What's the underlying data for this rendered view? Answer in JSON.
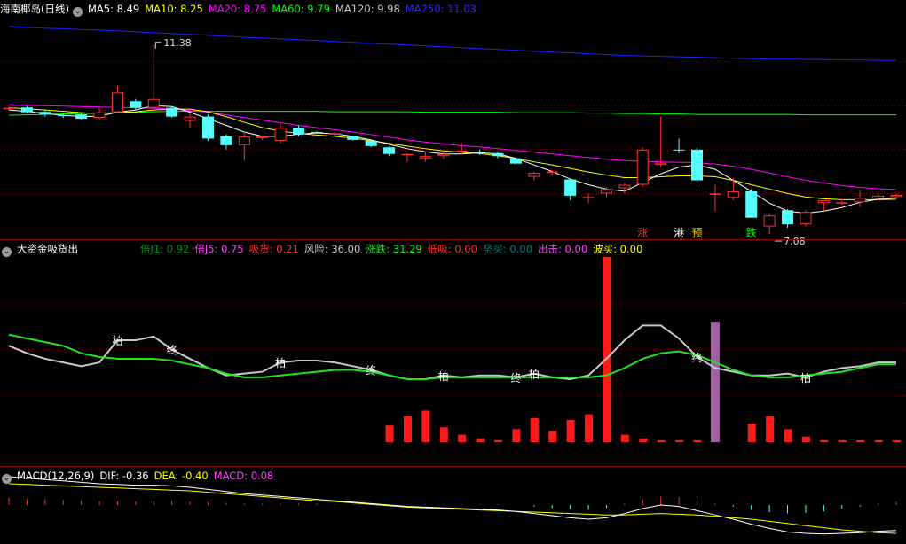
{
  "colors": {
    "up": "#ff3030",
    "down": "#54ffff",
    "ma5": "#ffffff",
    "ma10": "#ffff00",
    "ma20": "#ff00ff",
    "ma60": "#00ff00",
    "ma120": "#c8c8c8",
    "ma250": "#2020ff"
  },
  "main": {
    "title": "海南椰岛(日线)",
    "legend": [
      {
        "label": "MA5: 8.49",
        "color": "#ffffff"
      },
      {
        "label": "MA10: 8.25",
        "color": "#ffff00"
      },
      {
        "label": "MA20: 8.75",
        "color": "#ff00ff"
      },
      {
        "label": "MA60: 9.79",
        "color": "#00ff00"
      },
      {
        "label": "MA120: 9.98",
        "color": "#c8c8c8"
      },
      {
        "label": "MA250: 11.03",
        "color": "#2828ff"
      }
    ],
    "high_label": "11.38",
    "low_label": "7.08",
    "signals": [
      {
        "text": "涨",
        "i": 35,
        "color": "#ff3030"
      },
      {
        "text": "港",
        "i": 37,
        "color": "#ffffff"
      },
      {
        "text": "预",
        "i": 38,
        "color": "#ffd000"
      },
      {
        "text": "跌",
        "i": 41,
        "color": "#00ff00"
      }
    ]
  },
  "ind": {
    "title": "大资金吸货出",
    "legend": [
      {
        "label": "倍J1: 0.92",
        "color": "#009000"
      },
      {
        "label": "倍J5: 0.75",
        "color": "#ff40ff"
      },
      {
        "label": "吸货: 0.21",
        "color": "#ff3030"
      },
      {
        "label": "风险: 36.00",
        "color": "#c8c8c8"
      },
      {
        "label": "涨跌: 31.29",
        "color": "#00ff00"
      },
      {
        "label": "低吸: 0.00",
        "color": "#ff3030"
      },
      {
        "label": "坚买: 0.00",
        "color": "#007a7a"
      },
      {
        "label": "出击: 0.00",
        "color": "#ff40ff"
      },
      {
        "label": "波买: 0.00",
        "color": "#ffff00"
      }
    ],
    "marks": [
      {
        "text": "柏",
        "i": 6
      },
      {
        "text": "终",
        "i": 9
      },
      {
        "text": "柏",
        "i": 15
      },
      {
        "text": "终",
        "i": 20
      },
      {
        "text": "柏",
        "i": 24
      },
      {
        "text": "终",
        "i": 28
      },
      {
        "text": "柏",
        "i": 29
      },
      {
        "text": "终",
        "i": 38
      },
      {
        "text": "柏",
        "i": 44
      }
    ]
  },
  "macd": {
    "title": "MACD(12,26,9)",
    "legend": [
      {
        "label": "DIF: -0.36",
        "color": "#ffffff"
      },
      {
        "label": "DEA: -0.40",
        "color": "#ffff00"
      },
      {
        "label": "MACD: 0.08",
        "color": "#ff40ff"
      }
    ]
  },
  "chart_data": [
    {
      "type": "candlestick",
      "title": "海南椰岛(日线)",
      "candles": [
        [
          9.92,
          9.98,
          9.88,
          9.95
        ],
        [
          9.96,
          10.0,
          9.82,
          9.85
        ],
        [
          9.86,
          9.9,
          9.75,
          9.8
        ],
        [
          9.78,
          9.82,
          9.72,
          9.76
        ],
        [
          9.8,
          9.84,
          9.68,
          9.7
        ],
        [
          9.72,
          9.95,
          9.68,
          9.85
        ],
        [
          9.85,
          10.45,
          9.82,
          10.3
        ],
        [
          10.1,
          10.15,
          9.9,
          9.95
        ],
        [
          9.95,
          11.38,
          9.9,
          10.15
        ],
        [
          9.95,
          9.98,
          9.72,
          9.75
        ],
        [
          9.65,
          9.82,
          9.5,
          9.75
        ],
        [
          9.75,
          9.8,
          9.2,
          9.25
        ],
        [
          9.3,
          9.35,
          9.0,
          9.1
        ],
        [
          9.1,
          9.4,
          8.75,
          9.3
        ],
        [
          9.26,
          9.32,
          9.22,
          9.3
        ],
        [
          9.2,
          9.6,
          9.15,
          9.5
        ],
        [
          9.5,
          9.55,
          9.3,
          9.35
        ],
        [
          9.4,
          9.42,
          9.36,
          9.38
        ],
        [
          9.36,
          9.4,
          9.32,
          9.37
        ],
        [
          9.3,
          9.32,
          9.2,
          9.22
        ],
        [
          9.2,
          9.22,
          9.05,
          9.08
        ],
        [
          9.05,
          9.07,
          8.85,
          8.9
        ],
        [
          8.88,
          8.92,
          8.72,
          8.9
        ],
        [
          8.8,
          8.95,
          8.72,
          8.85
        ],
        [
          8.85,
          8.95,
          8.78,
          8.9
        ],
        [
          8.96,
          9.15,
          8.9,
          8.98
        ],
        [
          8.95,
          9.0,
          8.88,
          8.93
        ],
        [
          8.92,
          8.95,
          8.8,
          8.85
        ],
        [
          8.8,
          8.82,
          8.65,
          8.68
        ],
        [
          8.38,
          8.5,
          8.3,
          8.47
        ],
        [
          8.5,
          8.54,
          8.42,
          8.5
        ],
        [
          8.32,
          8.34,
          7.85,
          7.95
        ],
        [
          7.9,
          8.0,
          7.78,
          7.92
        ],
        [
          8.0,
          8.15,
          7.9,
          8.1
        ],
        [
          8.12,
          8.25,
          8.0,
          8.2
        ],
        [
          8.2,
          9.05,
          8.15,
          9.0
        ],
        [
          8.65,
          9.75,
          8.6,
          8.7
        ],
        [
          9.0,
          9.25,
          8.92,
          8.98
        ],
        [
          9.0,
          9.03,
          8.15,
          8.3
        ],
        [
          8.0,
          8.2,
          7.6,
          8.0
        ],
        [
          7.9,
          8.35,
          7.85,
          8.05
        ],
        [
          8.05,
          8.1,
          7.45,
          7.45
        ],
        [
          7.25,
          7.55,
          7.08,
          7.5
        ],
        [
          7.62,
          7.65,
          7.22,
          7.3
        ],
        [
          7.3,
          7.62,
          7.25,
          7.58
        ],
        [
          7.78,
          7.82,
          7.62,
          7.85
        ],
        [
          7.8,
          7.88,
          7.74,
          7.8
        ],
        [
          7.8,
          8.08,
          7.7,
          7.9
        ],
        [
          7.88,
          8.05,
          7.85,
          7.95
        ],
        [
          7.92,
          8.0,
          7.9,
          7.97
        ]
      ],
      "ma5": [
        9.9,
        9.87,
        9.82,
        9.78,
        9.75,
        9.76,
        9.85,
        9.9,
        10.0,
        9.98,
        9.85,
        9.7,
        9.55,
        9.4,
        9.3,
        9.3,
        9.35,
        9.38,
        9.36,
        9.3,
        9.22,
        9.12,
        9.02,
        8.95,
        8.9,
        8.9,
        8.93,
        8.9,
        8.8,
        8.65,
        8.5,
        8.33,
        8.2,
        8.1,
        8.05,
        8.25,
        8.45,
        8.6,
        8.65,
        8.55,
        8.3,
        8.05,
        7.78,
        7.6,
        7.55,
        7.6,
        7.68,
        7.8,
        7.87,
        7.9
      ],
      "ma10": [
        9.95,
        9.93,
        9.9,
        9.87,
        9.84,
        9.82,
        9.84,
        9.86,
        9.9,
        9.92,
        9.92,
        9.86,
        9.75,
        9.62,
        9.5,
        9.42,
        9.37,
        9.33,
        9.3,
        9.26,
        9.2,
        9.14,
        9.08,
        9.02,
        8.97,
        8.94,
        8.91,
        8.86,
        8.8,
        8.72,
        8.65,
        8.57,
        8.49,
        8.42,
        8.36,
        8.36,
        8.38,
        8.4,
        8.4,
        8.38,
        8.3,
        8.2,
        8.1,
        8.0,
        7.92,
        7.88,
        7.86,
        7.86,
        7.86,
        7.87
      ],
      "ma20": [
        10.02,
        10.01,
        10.0,
        9.99,
        9.98,
        9.97,
        9.96,
        9.95,
        9.94,
        9.92,
        9.89,
        9.85,
        9.79,
        9.73,
        9.67,
        9.61,
        9.55,
        9.5,
        9.45,
        9.4,
        9.34,
        9.28,
        9.22,
        9.17,
        9.13,
        9.09,
        9.06,
        9.02,
        8.98,
        8.94,
        8.9,
        8.86,
        8.82,
        8.78,
        8.75,
        8.73,
        8.72,
        8.71,
        8.7,
        8.67,
        8.62,
        8.55,
        8.47,
        8.38,
        8.3,
        8.24,
        8.18,
        8.14,
        8.11,
        8.09
      ],
      "ma60": [
        9.78,
        9.79,
        9.8,
        9.81,
        9.82,
        9.83,
        9.84,
        9.85,
        9.86,
        9.87,
        9.87,
        9.87,
        9.87,
        9.87,
        9.87,
        9.87,
        9.87,
        9.87,
        9.86,
        9.86,
        9.86,
        9.86,
        9.86,
        9.85,
        9.85,
        9.85,
        9.85,
        9.85,
        9.84,
        9.84,
        9.84,
        9.84,
        9.83,
        9.83,
        9.82,
        9.82,
        9.81,
        9.81,
        9.8,
        9.8,
        9.8,
        9.8,
        9.8,
        9.8,
        9.79,
        9.79,
        9.79,
        9.79,
        9.79,
        9.79
      ],
      "ma250": [
        11.8,
        11.78,
        11.76,
        11.75,
        11.73,
        11.72,
        11.7,
        11.68,
        11.66,
        11.64,
        11.62,
        11.6,
        11.58,
        11.56,
        11.54,
        11.52,
        11.5,
        11.48,
        11.46,
        11.44,
        11.42,
        11.4,
        11.38,
        11.36,
        11.34,
        11.32,
        11.3,
        11.28,
        11.26,
        11.24,
        11.22,
        11.2,
        11.18,
        11.16,
        11.14,
        11.13,
        11.12,
        11.11,
        11.1,
        11.09,
        11.08,
        11.07,
        11.06,
        11.06,
        11.05,
        11.05,
        11.04,
        11.04,
        11.03,
        11.03
      ],
      "price_range": [
        7.0,
        12.0
      ]
    },
    {
      "type": "line+bar",
      "title": "大资金吸货出",
      "line_white": [
        52,
        48,
        45,
        43,
        41,
        43,
        55,
        55,
        57,
        50,
        45,
        40,
        36,
        37,
        38,
        43,
        44,
        44,
        43,
        41,
        39,
        36,
        34,
        34,
        36,
        35,
        36,
        36,
        35,
        37,
        35,
        34,
        36,
        45,
        55,
        63,
        63,
        56,
        46,
        40,
        38,
        36,
        36,
        37,
        35,
        38,
        40,
        41,
        43,
        43
      ],
      "line_green": [
        58,
        56,
        54,
        52,
        48,
        46,
        45,
        45,
        45,
        44,
        42,
        40,
        37,
        35,
        35,
        36,
        37,
        38,
        39,
        39,
        38,
        36,
        34,
        34,
        35,
        35,
        35,
        35,
        35,
        35,
        35,
        35,
        35,
        36,
        40,
        45,
        48,
        49,
        47,
        43,
        39,
        36,
        35,
        35,
        36,
        37,
        38,
        40,
        42,
        42
      ],
      "bars_red": [
        0,
        0,
        0,
        0,
        0,
        0,
        0,
        0,
        0,
        0,
        0,
        0,
        0,
        0,
        0,
        0,
        0,
        0,
        0,
        0,
        0,
        9,
        14,
        17,
        8,
        4,
        2,
        1,
        7,
        13,
        6,
        12,
        15,
        100,
        4,
        2,
        1,
        1,
        1,
        8,
        0,
        10,
        14,
        7,
        3,
        1,
        1,
        1,
        1,
        1
      ],
      "bar_purple": {
        "i": 39,
        "value": 65
      },
      "range": [
        0,
        100
      ]
    },
    {
      "type": "macd",
      "title": "MACD(12,26,9)",
      "dif": [
        0.4,
        0.38,
        0.36,
        0.34,
        0.32,
        0.3,
        0.29,
        0.28,
        0.28,
        0.27,
        0.25,
        0.22,
        0.19,
        0.16,
        0.14,
        0.12,
        0.1,
        0.08,
        0.06,
        0.04,
        0.02,
        0.0,
        -0.02,
        -0.03,
        -0.04,
        -0.05,
        -0.06,
        -0.07,
        -0.09,
        -0.12,
        -0.15,
        -0.18,
        -0.2,
        -0.18,
        -0.12,
        -0.05,
        0.0,
        -0.02,
        -0.08,
        -0.14,
        -0.2,
        -0.27,
        -0.33,
        -0.38,
        -0.4,
        -0.41,
        -0.4,
        -0.39,
        -0.37,
        -0.36
      ],
      "dea": [
        0.3,
        0.29,
        0.28,
        0.27,
        0.26,
        0.25,
        0.24,
        0.23,
        0.22,
        0.21,
        0.2,
        0.18,
        0.16,
        0.14,
        0.12,
        0.1,
        0.08,
        0.06,
        0.05,
        0.03,
        0.01,
        -0.01,
        -0.03,
        -0.04,
        -0.05,
        -0.06,
        -0.07,
        -0.08,
        -0.09,
        -0.1,
        -0.11,
        -0.12,
        -0.13,
        -0.14,
        -0.14,
        -0.13,
        -0.12,
        -0.13,
        -0.14,
        -0.16,
        -0.18,
        -0.2,
        -0.23,
        -0.26,
        -0.29,
        -0.32,
        -0.35,
        -0.37,
        -0.39,
        -0.4
      ],
      "macd": [
        0.1,
        0.09,
        0.08,
        0.07,
        0.06,
        0.05,
        0.05,
        0.05,
        0.06,
        0.06,
        0.05,
        0.04,
        0.03,
        0.02,
        0.02,
        0.02,
        0.02,
        0.02,
        0.01,
        0.01,
        0.01,
        0.01,
        0.01,
        0.01,
        0.01,
        0.01,
        0.01,
        0.01,
        0.0,
        -0.02,
        -0.04,
        -0.06,
        -0.07,
        -0.04,
        0.02,
        0.08,
        0.12,
        0.11,
        0.06,
        0.02,
        -0.02,
        -0.07,
        -0.1,
        -0.12,
        -0.11,
        -0.09,
        -0.05,
        -0.02,
        0.02,
        0.04
      ]
    }
  ]
}
